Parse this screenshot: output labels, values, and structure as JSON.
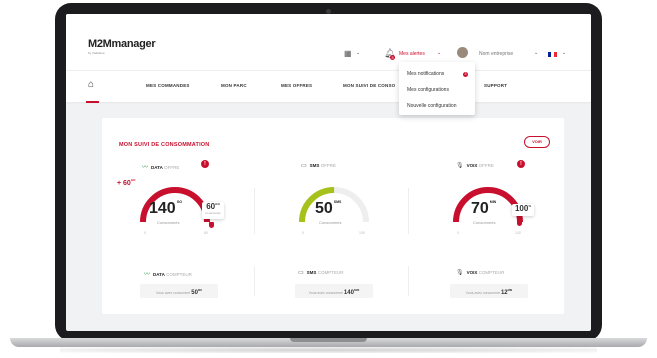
{
  "header": {
    "logo": "M2Mmanager",
    "logo_sub": "by Vodafone",
    "alerts_label": "Mes alertes",
    "alerts_badge": "3",
    "company": "Nom entreprise"
  },
  "nav": {
    "items": [
      "MES COMMANDES",
      "MON PARC",
      "MES OFFRES",
      "MON SUIVI DE CONSO",
      "SUPPORT"
    ]
  },
  "dropdown": {
    "items": [
      "Mes notifications",
      "Mes configurations",
      "Nouvelle configuration"
    ],
    "badge": "3"
  },
  "card": {
    "title": "MON SUIVI DE CONSOMMATION",
    "voir": "VOIR",
    "info": "!",
    "data": {
      "head_bold": "DATA",
      "head_light": "OFFRE",
      "value": "140",
      "unit": "GO",
      "consumed": "Consommés",
      "over": "+ 60",
      "over_unit": "GO",
      "bubble_value": "60",
      "bubble_unit": "GO",
      "bubble_sub": "en surconso",
      "min": "0",
      "max": "80",
      "counter_bold": "DATA",
      "counter_light": "COMPTEUR",
      "counter_text": "Vous avez consommé",
      "counter_value": "50",
      "counter_unit": "MO"
    },
    "sms": {
      "head_bold": "SMS",
      "head_light": "OFFRE",
      "value": "50",
      "unit": "SMS",
      "consumed": "Consommés",
      "min": "0",
      "max": "100",
      "counter_bold": "SMS",
      "counter_light": "COMPTEUR",
      "counter_text": "Vous avez consommé",
      "counter_value": "140",
      "counter_unit": "SMS"
    },
    "voix": {
      "head_bold": "VOIX",
      "head_light": "OFFRE",
      "value": "70",
      "unit": "MIN",
      "consumed": "Consommés",
      "bubble_value": "100",
      "bubble_unit": "%",
      "min": "0",
      "max": "140",
      "counter_bold": "VOIX",
      "counter_light": "COMPTEUR",
      "counter_text": "Vous avez consommé",
      "counter_value": "12",
      "counter_unit": "MIN"
    }
  },
  "colors": {
    "accent": "#c8102e",
    "sms_gauge": "#a6c21a",
    "gauge_track": "#eeeeee"
  },
  "gauges": {
    "data_fill": 1.0,
    "sms_fill": 0.5,
    "voix_fill": 1.0
  }
}
